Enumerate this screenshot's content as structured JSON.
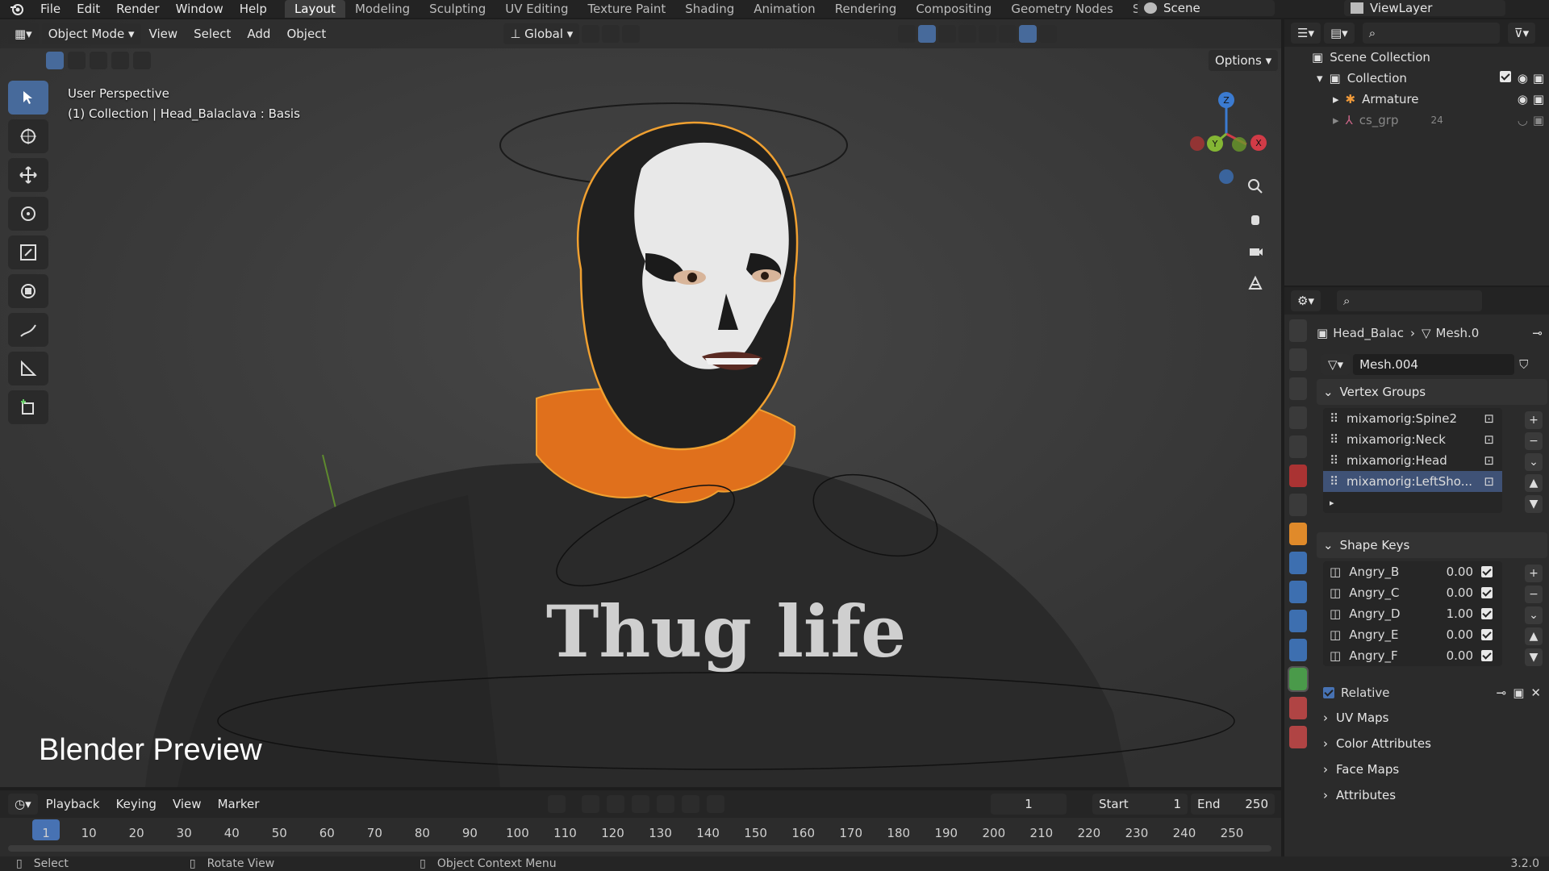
{
  "topbar": {
    "menus": [
      "File",
      "Edit",
      "Render",
      "Window",
      "Help"
    ],
    "workspaces": [
      "Layout",
      "Modeling",
      "Sculpting",
      "UV Editing",
      "Texture Paint",
      "Shading",
      "Animation",
      "Rendering",
      "Compositing",
      "Geometry Nodes",
      "Scripting"
    ],
    "active_workspace": "Layout",
    "scene": "Scene",
    "view_layer": "ViewLayer"
  },
  "viewport": {
    "mode": "Object Mode",
    "menus": [
      "View",
      "Select",
      "Add",
      "Object"
    ],
    "orientation": "Global",
    "options_label": "Options",
    "info_line1": "User Perspective",
    "info_line2": "(1) Collection | Head_Balaclava : Basis",
    "overlay_caption": "Blender Preview",
    "shirt_text": "Thug life",
    "gizmo_axes": [
      "Z",
      "Y",
      "X"
    ]
  },
  "timeline": {
    "menus": [
      "Playback",
      "Keying",
      "View",
      "Marker"
    ],
    "current_frame": "1",
    "start_label": "Start",
    "start_value": "1",
    "end_label": "End",
    "end_value": "250",
    "ticks": [
      "1",
      "10",
      "20",
      "30",
      "40",
      "50",
      "60",
      "70",
      "80",
      "90",
      "100",
      "110",
      "120",
      "130",
      "140",
      "150",
      "160",
      "170",
      "180",
      "190",
      "200",
      "210",
      "220",
      "230",
      "240",
      "250"
    ]
  },
  "statusbar": {
    "select": "Select",
    "rotate": "Rotate View",
    "context": "Object Context Menu",
    "version": "3.2.0"
  },
  "outliner": {
    "scene_collection": "Scene Collection",
    "collection": "Collection",
    "items": [
      "Armature",
      "cs_grp"
    ],
    "cs_grp_count": "24"
  },
  "properties": {
    "breadcrumb_object": "Head_Balac",
    "breadcrumb_mesh": "Mesh.0",
    "mesh_name": "Mesh.004",
    "vertex_groups_title": "Vertex Groups",
    "vertex_groups": [
      "mixamorig:Spine2",
      "mixamorig:Neck",
      "mixamorig:Head",
      "mixamorig:LeftSho..."
    ],
    "shape_keys_title": "Shape Keys",
    "shape_keys": [
      {
        "name": "Angry_B",
        "value": "0.00"
      },
      {
        "name": "Angry_C",
        "value": "0.00"
      },
      {
        "name": "Angry_D",
        "value": "1.00"
      },
      {
        "name": "Angry_E",
        "value": "0.00"
      },
      {
        "name": "Angry_F",
        "value": "0.00"
      }
    ],
    "relative_label": "Relative",
    "collapsed_panels": [
      "UV Maps",
      "Color Attributes",
      "Face Maps",
      "Attributes"
    ]
  },
  "colors": {
    "accent": "#4772b3",
    "selection_outline": "#f0a030",
    "hoodie_orange": "#e0701c"
  }
}
